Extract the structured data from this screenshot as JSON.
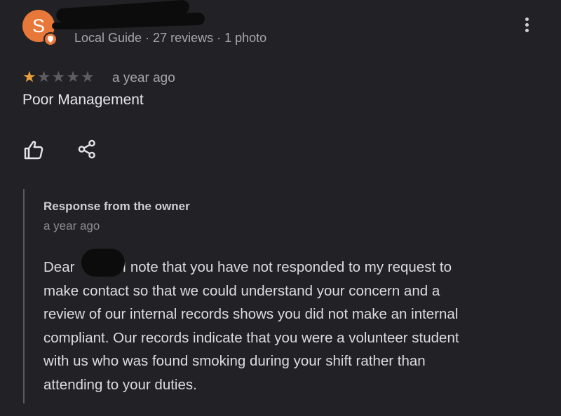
{
  "reviewer": {
    "avatar_letter": "S",
    "meta": "Local Guide · 27 reviews · 1 photo"
  },
  "review": {
    "rating": 1,
    "rating_max": 5,
    "time": "a year ago",
    "title": "Poor Management"
  },
  "owner_response": {
    "heading": "Response from the owner",
    "time": "a year ago",
    "lines": [
      {
        "before": "Dear",
        "after": "I note that you have not responded to my request to"
      },
      "make contact so that we could understand your concern and a",
      "review of our internal records shows you did not make an internal",
      "compliant. Our records indicate that you were a volunteer student",
      "with us who was found smoking during your shift rather than",
      "attending to your duties."
    ]
  },
  "icons": {
    "more": "more-vert-icon",
    "like": "thumb-up-icon",
    "share": "share-icon",
    "guide_badge": "local-guide-badge-icon",
    "star_filled": "star-filled-icon",
    "star_empty": "star-empty-icon"
  },
  "colors": {
    "background": "#222226",
    "avatar": "#e8783a",
    "star_filled": "#e8a03c",
    "star_empty": "#5c5c61",
    "primary_text": "#e6e6ea",
    "secondary_text": "#a6a6ab"
  }
}
